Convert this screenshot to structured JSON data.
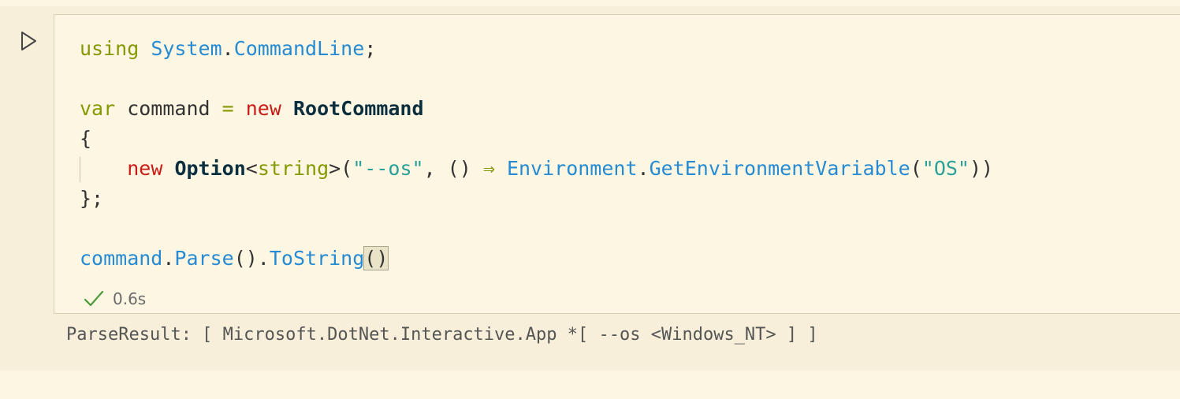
{
  "cell": {
    "run_icon": "play-icon",
    "code_lines": [
      [
        {
          "t": "using",
          "c": "kw-green"
        },
        {
          "t": " ",
          "c": "plain"
        },
        {
          "t": "System",
          "c": "ident-blue"
        },
        {
          "t": ".",
          "c": "plain"
        },
        {
          "t": "CommandLine",
          "c": "ident-blue"
        },
        {
          "t": ";",
          "c": "plain"
        }
      ],
      [],
      [
        {
          "t": "var",
          "c": "kw-green"
        },
        {
          "t": " command ",
          "c": "plain"
        },
        {
          "t": "=",
          "c": "kw-green"
        },
        {
          "t": " ",
          "c": "plain"
        },
        {
          "t": "new",
          "c": "kw-red"
        },
        {
          "t": " ",
          "c": "plain"
        },
        {
          "t": "RootCommand",
          "c": "type-bold"
        }
      ],
      [
        {
          "t": "{",
          "c": "plain"
        }
      ],
      [
        {
          "t": "    ",
          "c": "plain"
        },
        {
          "t": "new",
          "c": "kw-red"
        },
        {
          "t": " ",
          "c": "plain"
        },
        {
          "t": "Option",
          "c": "type-bold"
        },
        {
          "t": "<",
          "c": "plain"
        },
        {
          "t": "string",
          "c": "kw-green"
        },
        {
          "t": ">(",
          "c": "plain"
        },
        {
          "t": "\"--os\"",
          "c": "str"
        },
        {
          "t": ", () ",
          "c": "plain"
        },
        {
          "t": "⇒",
          "c": "kw-green"
        },
        {
          "t": " ",
          "c": "plain"
        },
        {
          "t": "Environment",
          "c": "ident-blue"
        },
        {
          "t": ".",
          "c": "plain"
        },
        {
          "t": "GetEnvironmentVariable",
          "c": "ident-blue"
        },
        {
          "t": "(",
          "c": "plain"
        },
        {
          "t": "\"OS\"",
          "c": "str"
        },
        {
          "t": "))",
          "c": "plain"
        }
      ],
      [
        {
          "t": "};",
          "c": "plain"
        }
      ],
      [],
      [
        {
          "t": "command",
          "c": "ident-blue"
        },
        {
          "t": ".",
          "c": "plain"
        },
        {
          "t": "Parse",
          "c": "ident-blue"
        },
        {
          "t": "().",
          "c": "plain"
        },
        {
          "t": "ToString",
          "c": "ident-blue"
        },
        {
          "t": "()",
          "c": "bracket-hl"
        }
      ]
    ],
    "status": {
      "icon": "check-icon",
      "duration": "0.6s"
    }
  },
  "output": {
    "text": "ParseResult: [ Microsoft.DotNet.Interactive.App *[ --os <Windows_NT> ] ]"
  },
  "colors": {
    "background": "#fdf6e3",
    "cell_band": "#f7efd9",
    "keyword_green": "#859900",
    "keyword_red": "#cb1b16",
    "identifier_blue": "#268bd2",
    "string_teal": "#2aa198",
    "type_dark": "#0b2f3f",
    "check_green": "#4a9a3a"
  }
}
